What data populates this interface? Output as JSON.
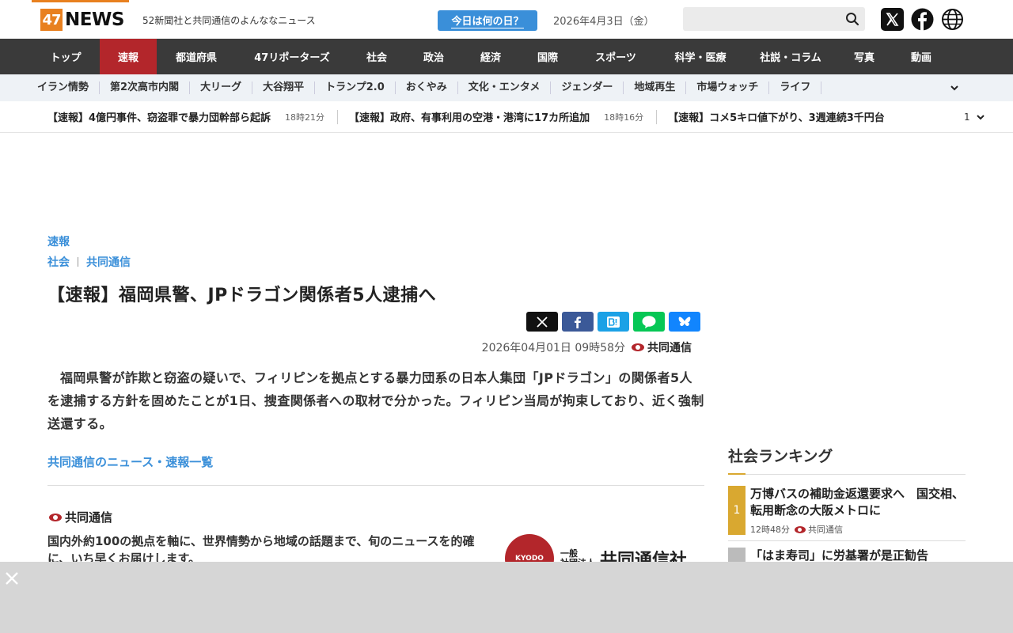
{
  "header": {
    "logo_number": "47",
    "logo_word": "NEWS",
    "tagline": "52新聞社と共同通信のよんななニュース",
    "today_button": "今日は何の日？",
    "date": "2026年4月3日（金）",
    "search_placeholder": ""
  },
  "mainnav": [
    {
      "label": "トップ",
      "width": 86
    },
    {
      "label": "速報",
      "width": 72,
      "active": true
    },
    {
      "label": "都道府県",
      "width": 100
    },
    {
      "label": "47リポーターズ",
      "width": 142
    },
    {
      "label": "社会",
      "width": 72
    },
    {
      "label": "政治",
      "width": 72
    },
    {
      "label": "経済",
      "width": 72
    },
    {
      "label": "国際",
      "width": 72
    },
    {
      "label": "スポーツ",
      "width": 100
    },
    {
      "label": "科学・医療",
      "width": 114
    },
    {
      "label": "社説・コラム",
      "width": 114
    },
    {
      "label": "写真",
      "width": 72
    },
    {
      "label": "動画",
      "width": 72
    }
  ],
  "subnav": [
    "イラン情勢",
    "第2次高市内閣",
    "大リーグ",
    "大谷翔平",
    "トランプ2.0",
    "おくやみ",
    "文化・エンタメ",
    "ジェンダー",
    "地域再生",
    "市場ウォッチ",
    "ライフ"
  ],
  "ticker": {
    "items": [
      {
        "headline": "【速報】4億円事件、窃盗罪で暴力団幹部ら起訴",
        "time": "18時21分"
      },
      {
        "headline": "【速報】政府、有事利用の空港・港湾に17カ所追加",
        "time": "18時16分"
      },
      {
        "headline": "【速報】コメ5キロ値下がり、3週連続3千円台",
        "time": ""
      }
    ],
    "page": "1"
  },
  "article": {
    "category": "速報",
    "section": "社会",
    "source_link": "共同通信",
    "title": "【速報】福岡県警、JPドラゴン関係者5人逮捕へ",
    "date": "2026年04月01日 09時58分",
    "source": "共同通信",
    "body": "福岡県警が詐欺と窃盗の疑いで、フィリピンを拠点とする暴力団系の日本人集団「JPドラゴン」の関係者5人を逮捕する方針を固めたことが1日、捜査関係者への取材で分かった。フィリピン当局が拘束しており、近く強制送還する。",
    "more_link": "共同通信のニュース・速報一覧",
    "source_block_name": "共同通信",
    "source_desc": "国内外約100の拠点を軸に、世界情勢から地域の話題まで、旬のニュースを的確に、いち早くお届けします。",
    "kyodo_logo_text": "KYODO",
    "kyodo_small": "一般\n社団法人",
    "kyodo_big": "共同通信社"
  },
  "ranking": {
    "title": "社会ランキング",
    "items": [
      {
        "rank": "1",
        "text": "万博バスの補助金返還要求へ　国交相、転用断念の大阪メトロに",
        "time": "12時48分",
        "source": "共同通信"
      },
      {
        "rank": "",
        "text": "「はま寿司」に労基署が是正勧告",
        "time": "",
        "source": ""
      }
    ]
  },
  "colors": {
    "accent_blue": "#3a8fd9",
    "nav_bg": "#3a3a3a",
    "nav_active": "#b3262b",
    "logo_orange": "#e8801f",
    "rank_gold": "#d9a830"
  }
}
